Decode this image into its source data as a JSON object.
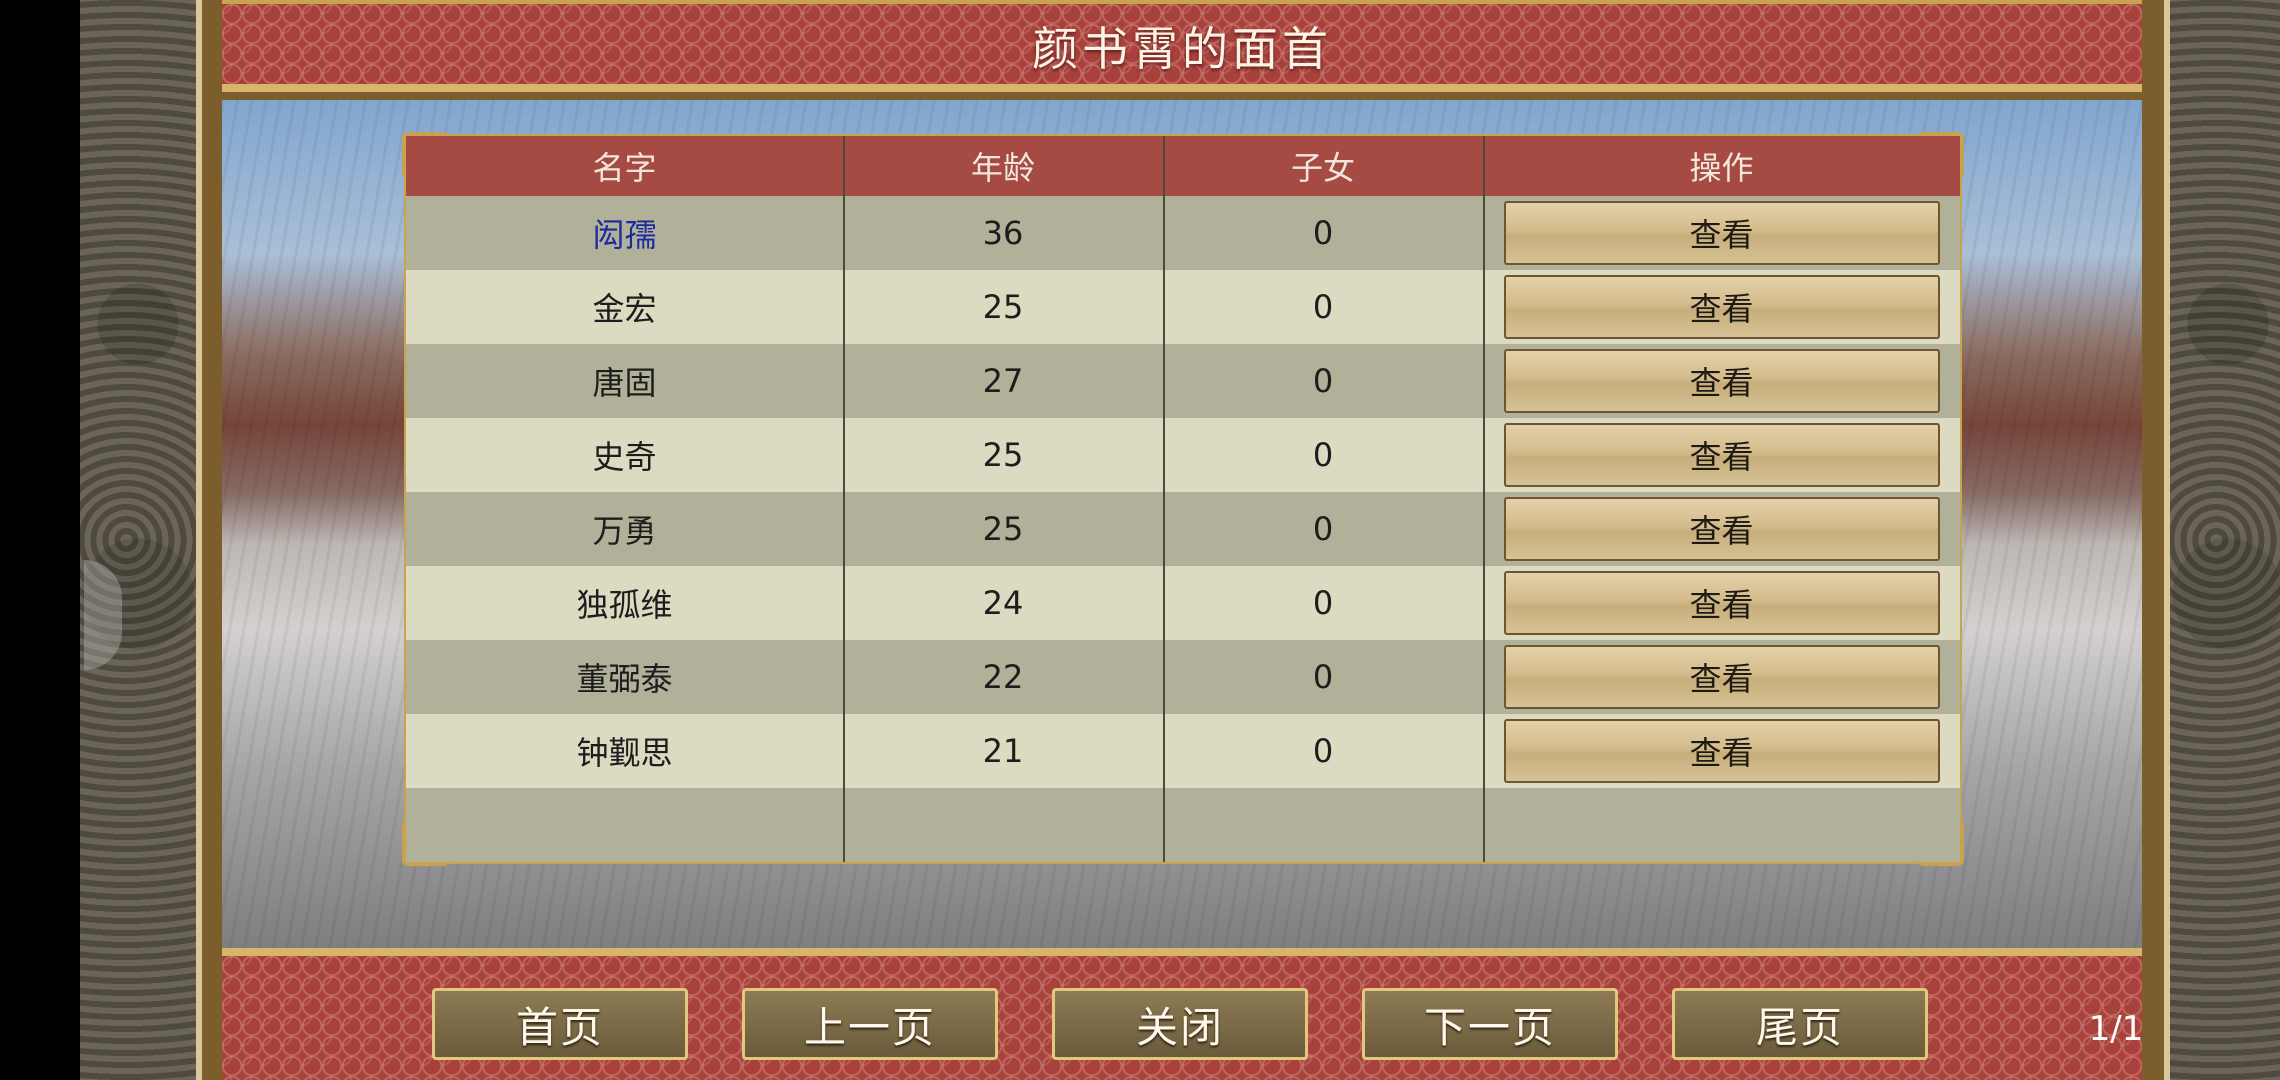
{
  "title": "颜书霄的面首",
  "table": {
    "headers": [
      "名字",
      "年龄",
      "子女",
      "操作"
    ],
    "rows": [
      {
        "name": "闳孺",
        "age": "36",
        "children": "0",
        "action": "查看"
      },
      {
        "name": "金宏",
        "age": "25",
        "children": "0",
        "action": "查看"
      },
      {
        "name": "唐固",
        "age": "27",
        "children": "0",
        "action": "查看"
      },
      {
        "name": "史奇",
        "age": "25",
        "children": "0",
        "action": "查看"
      },
      {
        "name": "万勇",
        "age": "25",
        "children": "0",
        "action": "查看"
      },
      {
        "name": "独孤维",
        "age": "24",
        "children": "0",
        "action": "查看"
      },
      {
        "name": "董弼泰",
        "age": "22",
        "children": "0",
        "action": "查看"
      },
      {
        "name": "钟觐思",
        "age": "21",
        "children": "0",
        "action": "查看"
      }
    ]
  },
  "footer": {
    "first_page": "首页",
    "prev_page": "上一页",
    "close": "关闭",
    "next_page": "下一页",
    "last_page": "尾页",
    "page_indicator": "1/1"
  },
  "colors": {
    "banner_red": "#a8413c",
    "header_red": "#a64a44",
    "gold_border": "#d7b56a",
    "row_dark": "#b1b098",
    "row_light": "#dcdbc2",
    "highlight_name": "#1a2aa0"
  }
}
